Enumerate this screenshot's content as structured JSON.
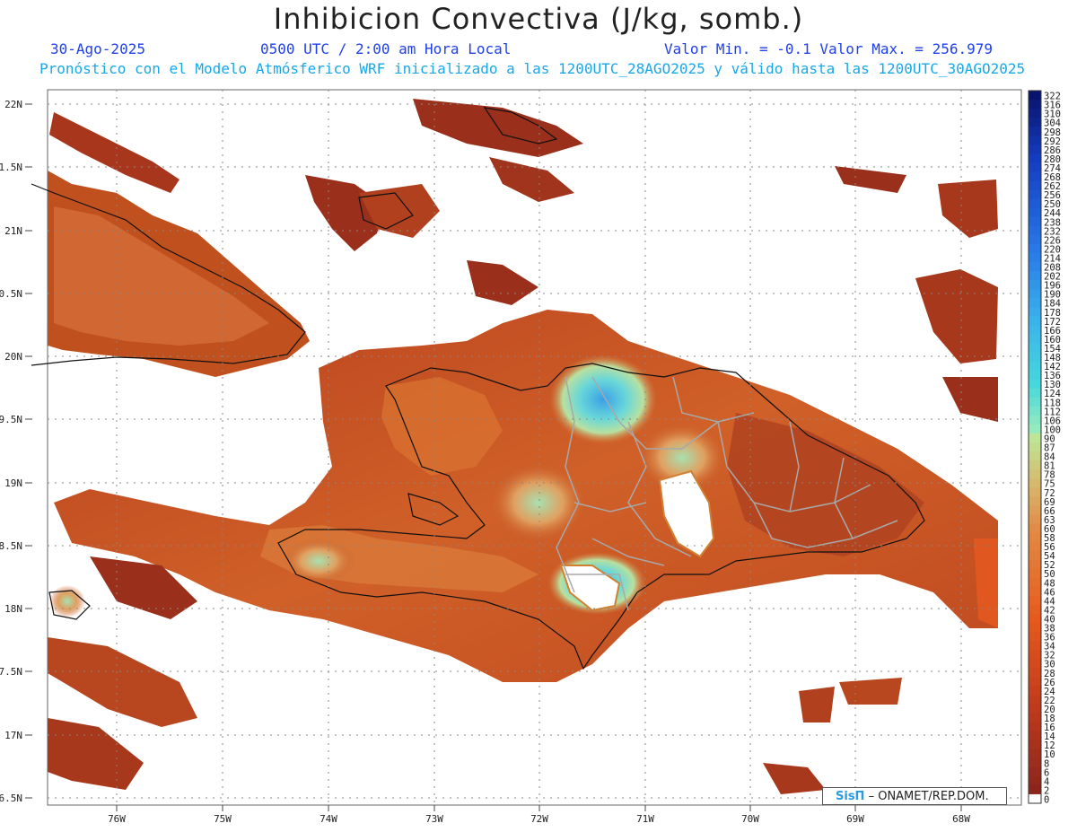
{
  "header": {
    "title": "Inhibicion Convectiva (J/kg, somb.)",
    "date": "30-Ago-2025",
    "valid_time": "0500 UTC / 2:00 am Hora Local",
    "min_max": "Valor Min. = -0.1  Valor Max. = 256.979",
    "forecast_note": "Pronóstico con el Modelo Atmósferico WRF inicializado a las 1200UTC_28AGO2025 y válido hasta las  1200UTC_30AGO2025"
  },
  "map": {
    "lat_labels": [
      "22N",
      "1.5N",
      "21N",
      "0.5N",
      "20N",
      "9.5N",
      "19N",
      "8.5N",
      "18N",
      "7.5N",
      "17N",
      "6.5N"
    ],
    "lon_labels": [
      "76W",
      "75W",
      "74W",
      "73W",
      "72W",
      "71W",
      "70W",
      "69W",
      "68W"
    ],
    "field_colors": {
      "low": "#8b2a1e",
      "mid": "#c24a20",
      "warm": "#e07a30",
      "tan": "#d8b070",
      "green": "#a8e0a0",
      "cyan": "#50d0e0",
      "blue": "#3aa0e8",
      "zero": "#ffffff"
    }
  },
  "colorbar": {
    "labels": [
      "322",
      "316",
      "310",
      "304",
      "298",
      "292",
      "286",
      "280",
      "274",
      "268",
      "262",
      "256",
      "250",
      "244",
      "238",
      "232",
      "226",
      "220",
      "214",
      "208",
      "202",
      "196",
      "190",
      "184",
      "178",
      "172",
      "166",
      "160",
      "154",
      "148",
      "142",
      "136",
      "130",
      "124",
      "118",
      "112",
      "106",
      "100",
      "90",
      "87",
      "84",
      "81",
      "78",
      "75",
      "72",
      "69",
      "66",
      "63",
      "60",
      "58",
      "56",
      "54",
      "52",
      "50",
      "48",
      "46",
      "44",
      "42",
      "40",
      "38",
      "36",
      "34",
      "32",
      "30",
      "28",
      "26",
      "24",
      "22",
      "20",
      "18",
      "16",
      "14",
      "12",
      "10",
      "8",
      "6",
      "4",
      "2",
      "0"
    ]
  },
  "credit": {
    "brand": "SisΠ",
    "text": "– ONAMET/REP.DOM."
  }
}
